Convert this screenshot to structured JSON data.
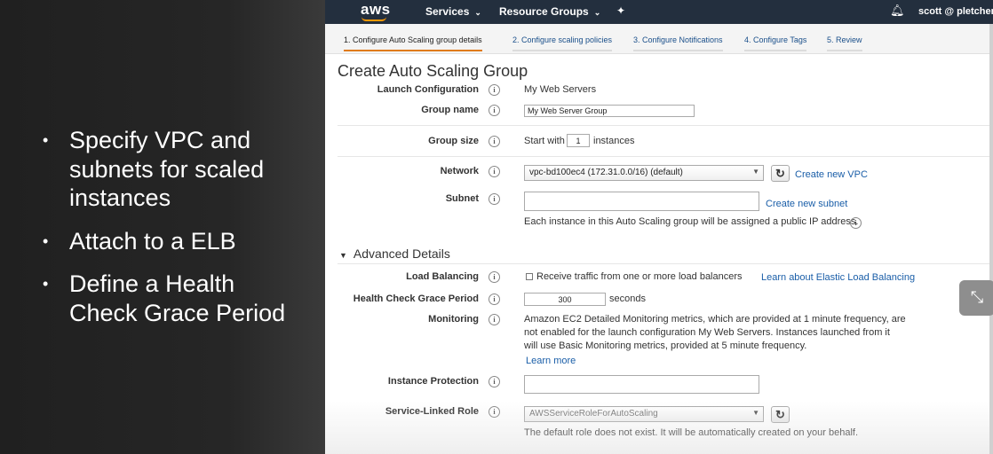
{
  "slide": {
    "bullets": [
      "Specify VPC and subnets for scaled instances",
      "Attach to a ELB",
      "Define a Health Check Grace Period"
    ]
  },
  "topnav": {
    "logo": "aws",
    "services": "Services",
    "resource_groups": "Resource Groups",
    "pin_icon": "pin-icon",
    "bell_icon": "bell-icon",
    "user": "scott @ pletcher-a"
  },
  "wizard": {
    "steps": [
      "1. Configure Auto Scaling group details",
      "2. Configure scaling policies",
      "3. Configure Notifications",
      "4. Configure Tags",
      "5. Review"
    ],
    "active_color": "#e07b18"
  },
  "form": {
    "title": "Create Auto Scaling Group",
    "launch_configuration": {
      "label": "Launch Configuration",
      "value": "My Web Servers"
    },
    "group_name": {
      "label": "Group name",
      "value": "My Web Server Group"
    },
    "group_size": {
      "label": "Group size",
      "prefix": "Start with",
      "value": "1",
      "suffix": "instances"
    },
    "network": {
      "label": "Network",
      "value": "vpc-bd100ec4 (172.31.0.0/16) (default)",
      "link": "Create new VPC"
    },
    "subnet": {
      "label": "Subnet",
      "value": "",
      "link": "Create new subnet",
      "note": "Each instance in this Auto Scaling group will be assigned a public IP address."
    },
    "advanced_title": "Advanced Details",
    "load_balancing": {
      "label": "Load Balancing",
      "checkbox_label": "Receive traffic from one or more load balancers",
      "link": "Learn about Elastic Load Balancing"
    },
    "grace_period": {
      "label": "Health Check Grace Period",
      "value": "300",
      "suffix": "seconds"
    },
    "monitoring": {
      "label": "Monitoring",
      "text": "Amazon EC2 Detailed Monitoring metrics, which are provided at 1 minute frequency, are not enabled for the launch configuration My Web Servers. Instances launched from it will use Basic Monitoring metrics, provided at 5 minute frequency.",
      "link": "Learn more"
    },
    "instance_protection": {
      "label": "Instance Protection",
      "value": ""
    },
    "service_role": {
      "label": "Service-Linked Role",
      "value": "AWSServiceRoleForAutoScaling",
      "note": "The default role does not exist. It will be automatically created on your behalf."
    }
  },
  "colors": {
    "nav_bg": "#232f3e",
    "link": "#1a5ea8",
    "accent": "#ff9900"
  }
}
